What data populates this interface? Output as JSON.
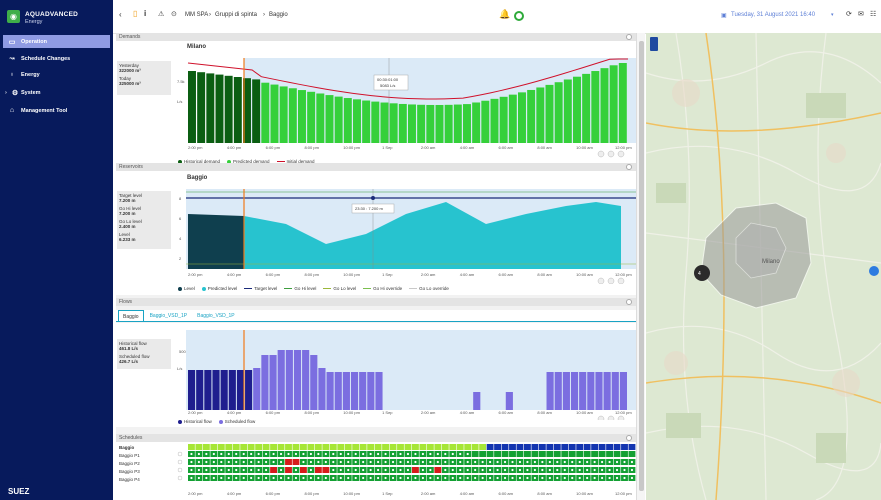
{
  "app": {
    "name": "AQUADVANCED",
    "subtitle": "Energy",
    "logo_icon": "suez-logo-icon",
    "footer": "SUEZ"
  },
  "sidebar": {
    "items": [
      {
        "label": "Operation",
        "icon": "monitor-icon",
        "active": true
      },
      {
        "label": "Schedule Changes",
        "icon": "chart-line-icon",
        "active": false
      },
      {
        "label": "Energy",
        "icon": "lightbulb-icon",
        "active": false
      },
      {
        "label": "System",
        "icon": "gear-icon",
        "active": false
      },
      {
        "label": "Management Tool",
        "icon": "factory-icon",
        "active": false
      }
    ]
  },
  "topbar": {
    "breadcrumb": [
      "MM SPA",
      "Gruppi di spinta",
      "Baggio"
    ],
    "datetime": "Tuesday, 31 August 2021 16:40",
    "colors": {
      "accent": "#19a3c4",
      "sidebar": "#071a5c",
      "active": "#8f9be3"
    }
  },
  "demands": {
    "section_label": "Demands",
    "chart_title": "Milano",
    "info": [
      {
        "label": "Yesterday",
        "value": "322000 m³"
      },
      {
        "label": "Today",
        "value": "325000 m³"
      }
    ],
    "tooltip": {
      "time": "00:30:01:00",
      "value": "5083 L/s"
    },
    "y_label": "L/s",
    "y_tick": "7.5k",
    "legend": [
      "Historical demand",
      "Predicted demand",
      "Initial demand"
    ]
  },
  "reservoirs": {
    "section_label": "Reservoirs",
    "chart_title": "Baggio",
    "info": [
      {
        "label": "Target level",
        "value": "7.200 m"
      },
      {
        "label": "Go Hi level",
        "value": "7.200 m"
      },
      {
        "label": "Go Lo level",
        "value": "2.400 m"
      },
      {
        "label": "Level",
        "value": "6.233 m"
      }
    ],
    "tooltip": "23:30 : 7.200 m",
    "y_label": "m",
    "y_ticks": [
      "8",
      "6",
      "4",
      "2"
    ],
    "legend": [
      "Level",
      "Predicted level",
      "Target level",
      "Go Hi level",
      "Go Lo level",
      "Go Hi override",
      "Go Lo override"
    ]
  },
  "flows": {
    "section_label": "Flows",
    "tabs": [
      "Baggio",
      "Baggio_VSD_1P",
      "Baggio_VSD_1P"
    ],
    "info": [
      {
        "label": "Historical flow",
        "value": "461.8 L/s"
      },
      {
        "label": "Scheduled flow",
        "value": "426.7 L/s"
      }
    ],
    "y_label": "L/s",
    "y_tick": "500",
    "legend": [
      "Historical flow",
      "Scheduled flow"
    ]
  },
  "schedules": {
    "section_label": "Schedules",
    "rows": [
      "Baggio",
      "Baggio P1",
      "Baggio P2",
      "Baggio P3",
      "Baggio P4"
    ]
  },
  "x_ticks": [
    "2:00 pm",
    "4:00 pm",
    "6:00 pm",
    "8:00 pm",
    "10:00 pm",
    "1 Sep",
    "2:00 am",
    "4:00 am",
    "6:00 am",
    "8:00 am",
    "10:00 am",
    "12:00 pm"
  ],
  "map": {
    "label": "Milano",
    "marker": "4"
  }
}
